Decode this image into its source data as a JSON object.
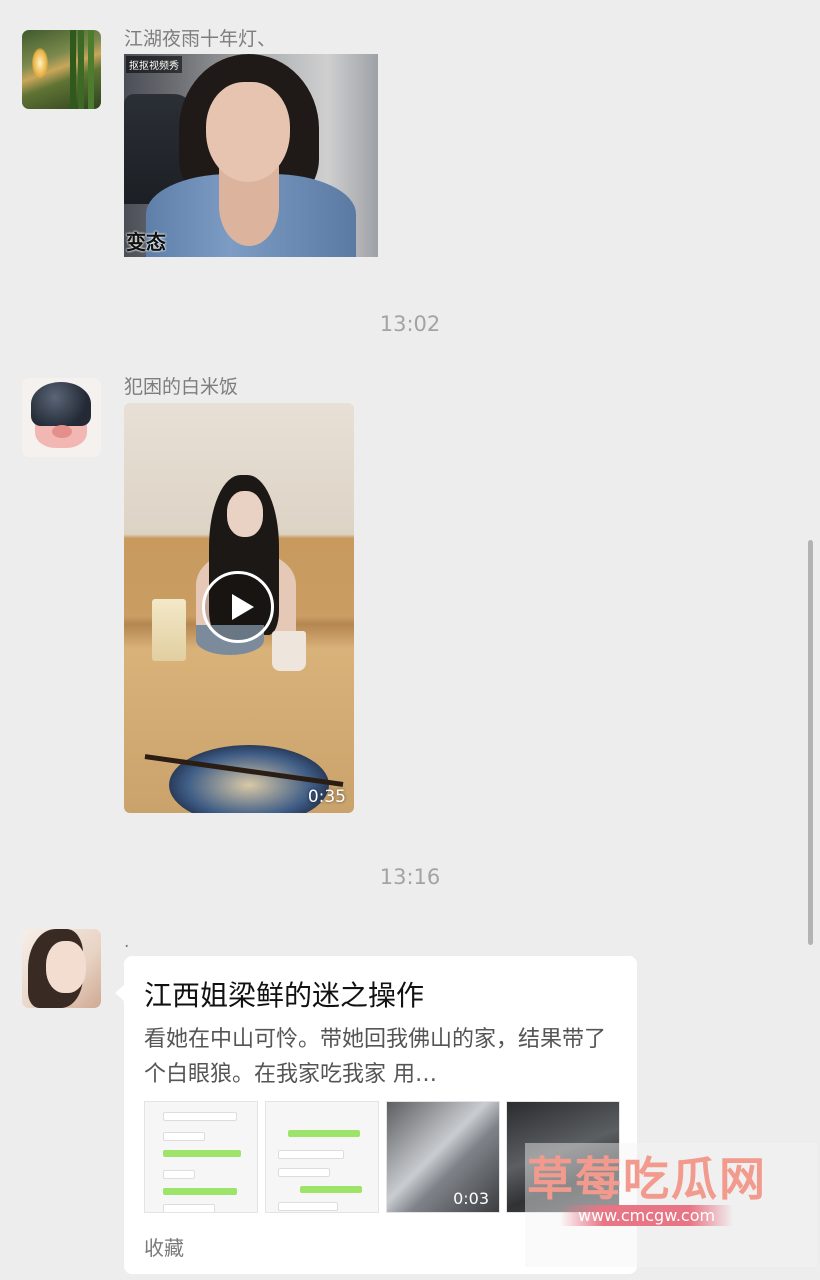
{
  "messages": [
    {
      "sender": "江湖夜雨十年灯、",
      "image": {
        "tag": "抠抠视频秀",
        "caption": "变态"
      }
    },
    {
      "timestamp": "13:02",
      "sender": "犯困的白米饭",
      "video": {
        "duration": "0:35"
      }
    },
    {
      "timestamp": "13:16",
      "sender": ".",
      "card": {
        "title": "江西姐梁鲜的迷之操作",
        "description": "看她在中山可怜。带她回我佛山的家，结果带了个白眼狼。在我家吃我家 用…",
        "thumb_video_duration": "0:03",
        "source": "收藏"
      }
    }
  ],
  "watermark": {
    "text": "草莓吃瓜网",
    "url": "www.cmcgw.com"
  },
  "colors": {
    "background": "#ededed",
    "bubble": "#ffffff",
    "timestamp": "#a3a3a3",
    "sender": "#7d7d7d",
    "watermark": "#f39a8e"
  },
  "icons": {
    "play": "play-icon"
  }
}
